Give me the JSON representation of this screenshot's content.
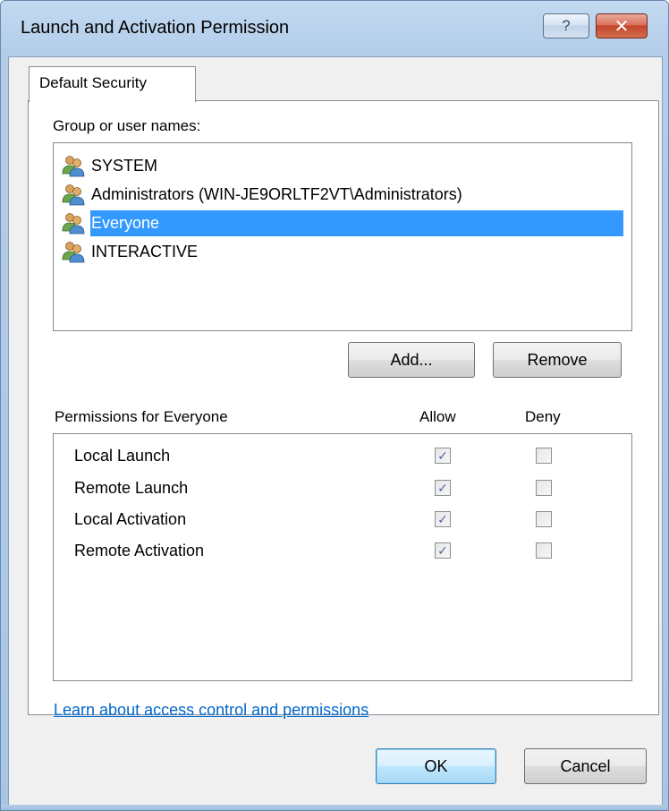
{
  "window": {
    "title": "Launch and Activation Permission",
    "help_glyph": "?",
    "close_glyph": "✕"
  },
  "tab": {
    "label": "Default Security"
  },
  "group_section": {
    "label": "Group or user names:",
    "items": [
      {
        "name": "SYSTEM",
        "icon": "users-icon",
        "selected": false
      },
      {
        "name": "Administrators (WIN-JE9ORLTF2VT\\Administrators)",
        "icon": "users-icon",
        "selected": false
      },
      {
        "name": "Everyone",
        "icon": "users-icon",
        "selected": true
      },
      {
        "name": "INTERACTIVE",
        "icon": "users-icon",
        "selected": false
      }
    ]
  },
  "buttons": {
    "add": "Add...",
    "remove": "Remove",
    "ok": "OK",
    "cancel": "Cancel"
  },
  "permissions": {
    "label": "Permissions for Everyone",
    "allow_header": "Allow",
    "deny_header": "Deny",
    "check_glyph": "✓",
    "rows": [
      {
        "name": "Local Launch",
        "allow": true,
        "deny": false
      },
      {
        "name": "Remote Launch",
        "allow": true,
        "deny": false
      },
      {
        "name": "Local Activation",
        "allow": true,
        "deny": false
      },
      {
        "name": "Remote Activation",
        "allow": true,
        "deny": false
      }
    ]
  },
  "link": {
    "text": "Learn about access control and permissions"
  },
  "colors": {
    "selection": "#3399ff",
    "link": "#0066cc",
    "close_button": "#c4442a"
  }
}
